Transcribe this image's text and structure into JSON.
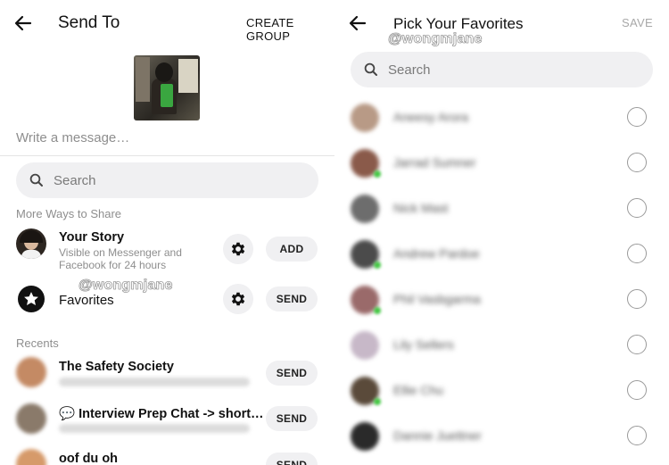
{
  "left": {
    "header": {
      "title": "Send To",
      "action": "CREATE GROUP"
    },
    "watermark": "@wongmjane",
    "message_placeholder": "Write a message…",
    "search_placeholder": "Search",
    "more_ways_label": "More Ways to Share",
    "story": {
      "title": "Your Story",
      "subtitle": "Visible on Messenger and Facebook for 24 hours",
      "action": "ADD"
    },
    "favorites": {
      "title": "Favorites",
      "action": "SEND"
    },
    "recents_label": "Recents",
    "recents": [
      {
        "title": "The Safety Society",
        "action": "SEND"
      },
      {
        "title": "💬 Interview Prep Chat -> short…",
        "action": "SEND"
      },
      {
        "title": "oof du oh",
        "action": "SEND"
      }
    ]
  },
  "right": {
    "header": {
      "title": "Pick Your Favorites",
      "action": "SAVE"
    },
    "watermark": "@wongmjane",
    "search_placeholder": "Search",
    "contacts": [
      {
        "name": "Aneesy Arora",
        "color": "#b89a86",
        "online": false
      },
      {
        "name": "Jarrad Sumner",
        "color": "#8a5a4a",
        "online": true
      },
      {
        "name": "Nick Mast",
        "color": "#6d6d6d",
        "online": false
      },
      {
        "name": "Andrew Pardoe",
        "color": "#4b4b4b",
        "online": true
      },
      {
        "name": "Phil Vasbgarma",
        "color": "#9a6a6a",
        "online": true
      },
      {
        "name": "Lily Sellers",
        "color": "#c7b8c8",
        "online": false
      },
      {
        "name": "Ellie Chu",
        "color": "#5a4a3a",
        "online": true
      },
      {
        "name": "Dannie Juettner",
        "color": "#2a2a2a",
        "online": false
      }
    ]
  },
  "colors": {
    "surface": "#f0f0f2",
    "muted_text": "#8e8e8e",
    "online": "#43c743"
  }
}
